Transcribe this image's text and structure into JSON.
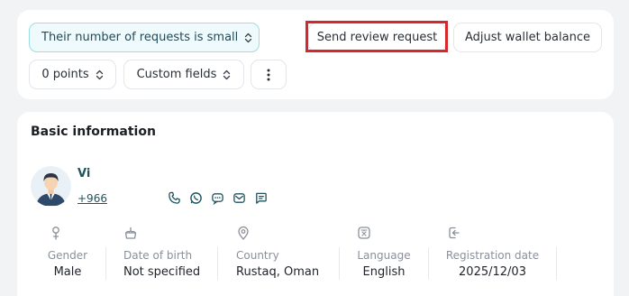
{
  "toolbar": {
    "filter_label": "Their number of requests is small",
    "send_review_label": "Send review request",
    "adjust_wallet_label": "Adjust wallet balance",
    "points_label": "0 points",
    "custom_fields_label": "Custom fields",
    "more_icon": "more-vertical-icon"
  },
  "basic_info": {
    "title": "Basic information",
    "customer": {
      "name": "Vi",
      "phone": "+966"
    },
    "contact_icons": [
      "phone-icon",
      "whatsapp-icon",
      "sms-icon",
      "email-icon",
      "chat-icon"
    ],
    "fields": [
      {
        "icon": "gender-icon",
        "label": "Gender",
        "value": "Male"
      },
      {
        "icon": "cake-icon",
        "label": "Date of birth",
        "value": "Not specified"
      },
      {
        "icon": "location-pin-icon",
        "label": "Country",
        "value": "Rustaq, Oman"
      },
      {
        "icon": "language-icon",
        "label": "Language",
        "value": "English"
      },
      {
        "icon": "sign-in-icon",
        "label": "Registration date",
        "value": "2025/12/03"
      }
    ]
  },
  "colors": {
    "accent": "#1f5460",
    "highlight": "#d7262c",
    "filter_bg": "#eefafb",
    "filter_border": "#9ddde3"
  }
}
